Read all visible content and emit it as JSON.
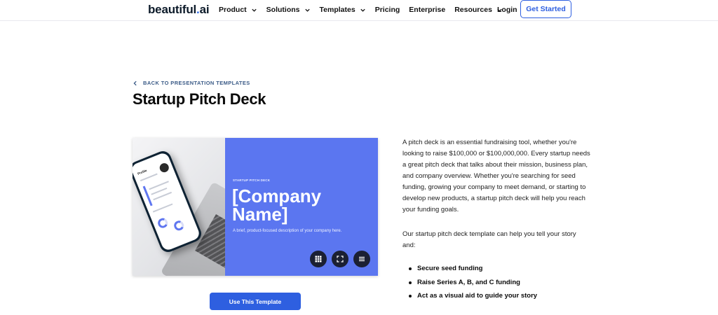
{
  "header": {
    "logo": {
      "main": "beautiful",
      "dot": ".",
      "suffix": "ai"
    },
    "nav": [
      {
        "label": "Product",
        "dropdown": true
      },
      {
        "label": "Solutions",
        "dropdown": true
      },
      {
        "label": "Templates",
        "dropdown": true
      },
      {
        "label": "Pricing",
        "dropdown": false
      },
      {
        "label": "Enterprise",
        "dropdown": false
      },
      {
        "label": "Resources",
        "dropdown": true
      }
    ],
    "login": "Login",
    "cta": "Get Started"
  },
  "page": {
    "back_link": "BACK TO PRESENTATION TEMPLATES",
    "title": "Startup Pitch Deck"
  },
  "preview": {
    "phone_heading": "Profile",
    "slide_kicker": "STARTUP PITCH DECK",
    "slide_title": "[Company Name]",
    "slide_subtitle": "A brief, product-focused description of your company here.",
    "controls": [
      "grid-icon",
      "fullscreen-icon",
      "menu-icon"
    ]
  },
  "use_button": "Use This Template",
  "description": {
    "paragraph1": "A pitch deck is an essential fundraising tool, whether you're looking to raise $100,000 or $100,000,000. Every startup needs a great pitch deck that talks about their mission, business plan, and company overview. Whether you're searching for seed funding, growing your company to meet demand, or starting to develop new products, a startup pitch deck will help you reach your funding goals.",
    "paragraph2": "Our startup pitch deck template can help you tell your story and:",
    "bullets": [
      "Secure seed funding",
      "Raise Series A, B, and C funding",
      "Act as a visual aid to guide your story"
    ]
  },
  "colors": {
    "brand_blue": "#2e5fe0",
    "slide_blue": "#5b76f0",
    "control_dark": "#1b2033",
    "back_link": "#3b5b87"
  }
}
